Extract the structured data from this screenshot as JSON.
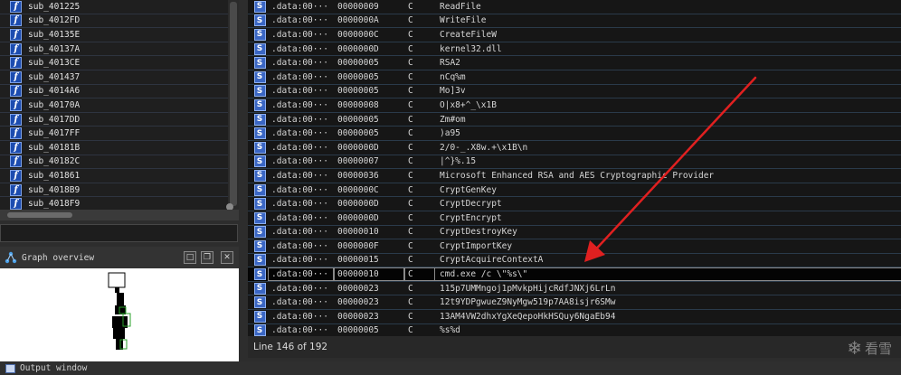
{
  "functions": [
    "sub_401225",
    "sub_4012FD",
    "sub_40135E",
    "sub_40137A",
    "sub_4013CE",
    "sub_401437",
    "sub_4014A6",
    "sub_40170A",
    "sub_4017DD",
    "sub_4017FF",
    "sub_40181B",
    "sub_40182C",
    "sub_401861",
    "sub_4018B9",
    "sub_4018F9"
  ],
  "function_icon": "f",
  "graph_overview": {
    "title": "Graph overview",
    "icon": "graph-icon"
  },
  "strings": {
    "rows": [
      {
        "address": ".data:00···",
        "length": "00000009",
        "type": "C",
        "value": "ReadFile"
      },
      {
        "address": ".data:00···",
        "length": "0000000A",
        "type": "C",
        "value": "WriteFile"
      },
      {
        "address": ".data:00···",
        "length": "0000000C",
        "type": "C",
        "value": "CreateFileW"
      },
      {
        "address": ".data:00···",
        "length": "0000000D",
        "type": "C",
        "value": "kernel32.dll"
      },
      {
        "address": ".data:00···",
        "length": "00000005",
        "type": "C",
        "value": "RSA2"
      },
      {
        "address": ".data:00···",
        "length": "00000005",
        "type": "C",
        "value": "nCq%m"
      },
      {
        "address": ".data:00···",
        "length": "00000005",
        "type": "C",
        "value": "Mo]3v"
      },
      {
        "address": ".data:00···",
        "length": "00000008",
        "type": "C",
        "value": "O|x8+^_\\x1B"
      },
      {
        "address": ".data:00···",
        "length": "00000005",
        "type": "C",
        "value": "Zm#om"
      },
      {
        "address": ".data:00···",
        "length": "00000005",
        "type": "C",
        "value": ")a95"
      },
      {
        "address": ".data:00···",
        "length": "0000000D",
        "type": "C",
        "value": "2/0-_.X8w.+\\x1B\\n"
      },
      {
        "address": ".data:00···",
        "length": "00000007",
        "type": "C",
        "value": "|^}%.15"
      },
      {
        "address": ".data:00···",
        "length": "00000036",
        "type": "C",
        "value": "Microsoft Enhanced RSA and AES Cryptographic Provider"
      },
      {
        "address": ".data:00···",
        "length": "0000000C",
        "type": "C",
        "value": "CryptGenKey"
      },
      {
        "address": ".data:00···",
        "length": "0000000D",
        "type": "C",
        "value": "CryptDecrypt"
      },
      {
        "address": ".data:00···",
        "length": "0000000D",
        "type": "C",
        "value": "CryptEncrypt"
      },
      {
        "address": ".data:00···",
        "length": "00000010",
        "type": "C",
        "value": "CryptDestroyKey"
      },
      {
        "address": ".data:00···",
        "length": "0000000F",
        "type": "C",
        "value": "CryptImportKey"
      },
      {
        "address": ".data:00···",
        "length": "00000015",
        "type": "C",
        "value": "CryptAcquireContextA"
      },
      {
        "address": ".data:00···",
        "length": "00000010",
        "type": "C",
        "value": "cmd.exe /c \\\"%s\\\"",
        "selected": true
      },
      {
        "address": ".data:00···",
        "length": "00000023",
        "type": "C",
        "value": "115p7UMMngoj1pMvkpHijcRdfJNXj6LrLn"
      },
      {
        "address": ".data:00···",
        "length": "00000023",
        "type": "C",
        "value": "12t9YDPgwueZ9NyMgw519p7AA8isjr6SMw"
      },
      {
        "address": ".data:00···",
        "length": "00000023",
        "type": "C",
        "value": "13AM4VW2dhxYgXeQepoHkHSQuy6NgaEb94"
      },
      {
        "address": ".data:00···",
        "length": "00000005",
        "type": "C",
        "value": "%s%d"
      }
    ],
    "row_icon": "S"
  },
  "status": {
    "line": "Line 146 of 192"
  },
  "watermark": {
    "text": "看雪",
    "icon": "snowflake-icon"
  },
  "output_window": {
    "title": "Output window",
    "icon": "window-icon"
  },
  "colors": {
    "function_icon": "#1c4cb0",
    "string_icon": "#3a66c4",
    "annotation_arrow": "#e02020",
    "pane_bg": "#161616"
  }
}
